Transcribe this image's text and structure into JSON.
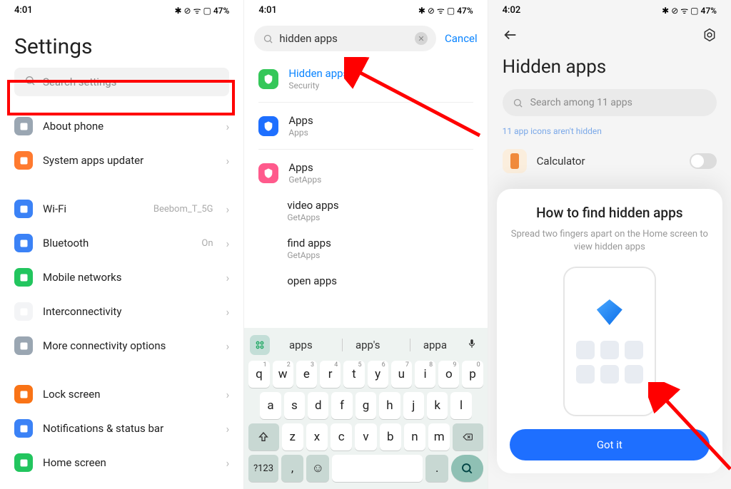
{
  "status": {
    "time1": "4:01",
    "time2": "4:01",
    "time3": "4:02",
    "indicators": "✱ ⊘ ᯤ ▢ 47%"
  },
  "screen1": {
    "title": "Settings",
    "searchPlaceholder": "Search settings",
    "items": [
      {
        "label": "About phone",
        "color": "#9aa6b2",
        "value": "",
        "icon": "phone"
      },
      {
        "label": "System apps updater",
        "color": "#ff7a2f",
        "value": "",
        "icon": "up"
      }
    ],
    "items2": [
      {
        "label": "Wi-Fi",
        "color": "#3b82f6",
        "value": "Beebom_T_5G"
      },
      {
        "label": "Bluetooth",
        "color": "#3b82f6",
        "value": "On"
      },
      {
        "label": "Mobile networks",
        "color": "#22c55e",
        "value": ""
      },
      {
        "label": "Interconnectivity",
        "color": "#f3f4f6",
        "value": ""
      },
      {
        "label": "More connectivity options",
        "color": "#9aa6b2",
        "value": ""
      }
    ],
    "items3": [
      {
        "label": "Lock screen",
        "color": "#f97316"
      },
      {
        "label": "Notifications & status bar",
        "color": "#3b82f6"
      },
      {
        "label": "Home screen",
        "color": "#22c55e"
      }
    ]
  },
  "screen2": {
    "query": "hidden apps",
    "cancel": "Cancel",
    "results": [
      {
        "title": "Hidden apps",
        "sub": "Security",
        "kind": "shield",
        "color": "#34c759",
        "highlight": true
      },
      {
        "title": "Apps",
        "sub": "Apps",
        "kind": "app",
        "color": "#1e6fff"
      },
      {
        "title": "Apps",
        "sub": "GetApps",
        "kind": "getapps",
        "color": "#ff5a8c"
      },
      {
        "title": "video apps",
        "sub": "GetApps",
        "indent": true
      },
      {
        "title": "find apps",
        "sub": "GetApps",
        "indent": true
      },
      {
        "title": "open apps",
        "sub": "",
        "indent": true
      }
    ],
    "suggestions": [
      "apps",
      "app's",
      "appa"
    ],
    "row1": [
      "q",
      "w",
      "e",
      "r",
      "t",
      "y",
      "u",
      "i",
      "o",
      "p"
    ],
    "hints1": [
      "1",
      "2",
      "3",
      "4",
      "5",
      "6",
      "7",
      "8",
      "9",
      "0"
    ],
    "row2": [
      "a",
      "s",
      "d",
      "f",
      "g",
      "h",
      "j",
      "k",
      "l"
    ],
    "row3": [
      "z",
      "x",
      "c",
      "v",
      "b",
      "n",
      "m"
    ],
    "fnLabel": "?123",
    "comma": ",",
    "period": "."
  },
  "screen3": {
    "title": "Hidden apps",
    "searchPlaceholder": "Search among 11 apps",
    "note": "11 app icons aren't hidden",
    "appName": "Calculator",
    "overlay": {
      "title": "How to find hidden apps",
      "subtitle": "Spread two fingers apart on the Home screen to view hidden apps",
      "button": "Got it"
    }
  }
}
